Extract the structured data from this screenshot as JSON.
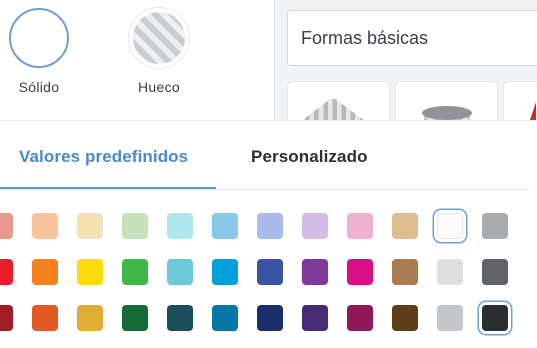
{
  "fill_options": [
    {
      "label": "Sólido"
    },
    {
      "label": "Hueco"
    }
  ],
  "shape_category": {
    "value": "Formas básicas"
  },
  "tabs": [
    {
      "label": "Valores predefinidos"
    },
    {
      "label": "Personalizado"
    }
  ],
  "palette": [
    [
      "#e8988f",
      "#f8c39d",
      "#f4e2b3",
      "#c8e1bd",
      "#b2e6ee",
      "#88c9e8",
      "#a9b9ec",
      "#d3bde8",
      "#efb3d2",
      "#dfbd91",
      "#fcfcfc",
      "#a8acb0"
    ],
    [
      "#e91d2c",
      "#f5821f",
      "#fedc10",
      "#41b649",
      "#6dc9d9",
      "#00a0db",
      "#3a53a4",
      "#7f3a98",
      "#da0f84",
      "#a87b52",
      "#dcdee0",
      "#606469"
    ],
    [
      "#a01d23",
      "#e35a25",
      "#e2ad33",
      "#156b37",
      "#1b4d5d",
      "#0477a6",
      "#192e6a",
      "#472c74",
      "#8d1a57",
      "#5e3d18",
      "#c3c7cc",
      "#2a2d31"
    ]
  ],
  "selected_swatches": [
    "row1-col11",
    "row3-col12"
  ]
}
